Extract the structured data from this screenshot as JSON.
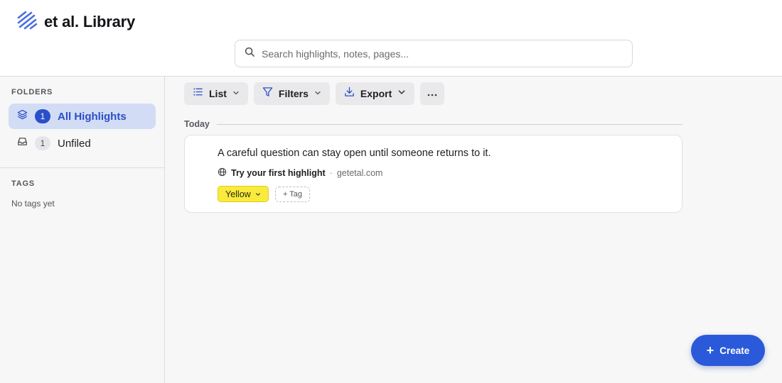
{
  "app": {
    "title": "et al. Library",
    "brand_color": "#4a6fe0"
  },
  "search": {
    "placeholder": "Search highlights, notes, pages..."
  },
  "sidebar": {
    "folders_title": "FOLDERS",
    "folders": [
      {
        "label": "All Highlights",
        "count": "1",
        "icon": "layers-icon",
        "active": true
      },
      {
        "label": "Unfiled",
        "count": "1",
        "icon": "inbox-icon",
        "active": false
      }
    ],
    "tags_title": "TAGS",
    "tags_empty": "No tags yet"
  },
  "toolbar": {
    "view_label": "List",
    "filters_label": "Filters",
    "export_label": "Export",
    "more_icon": "ellipsis-icon"
  },
  "main": {
    "group_label": "Today",
    "highlights": [
      {
        "text": "A careful question can stay open until someone returns to it.",
        "source_title": "Try your first highlight",
        "source_separator": "·",
        "source_domain": "getetal.com",
        "color_label": "Yellow",
        "color_hex": "#f9ea3e",
        "add_tag_label": "+ Tag"
      }
    ]
  },
  "create_button": {
    "label": "Create",
    "color": "#2a5ad9"
  }
}
